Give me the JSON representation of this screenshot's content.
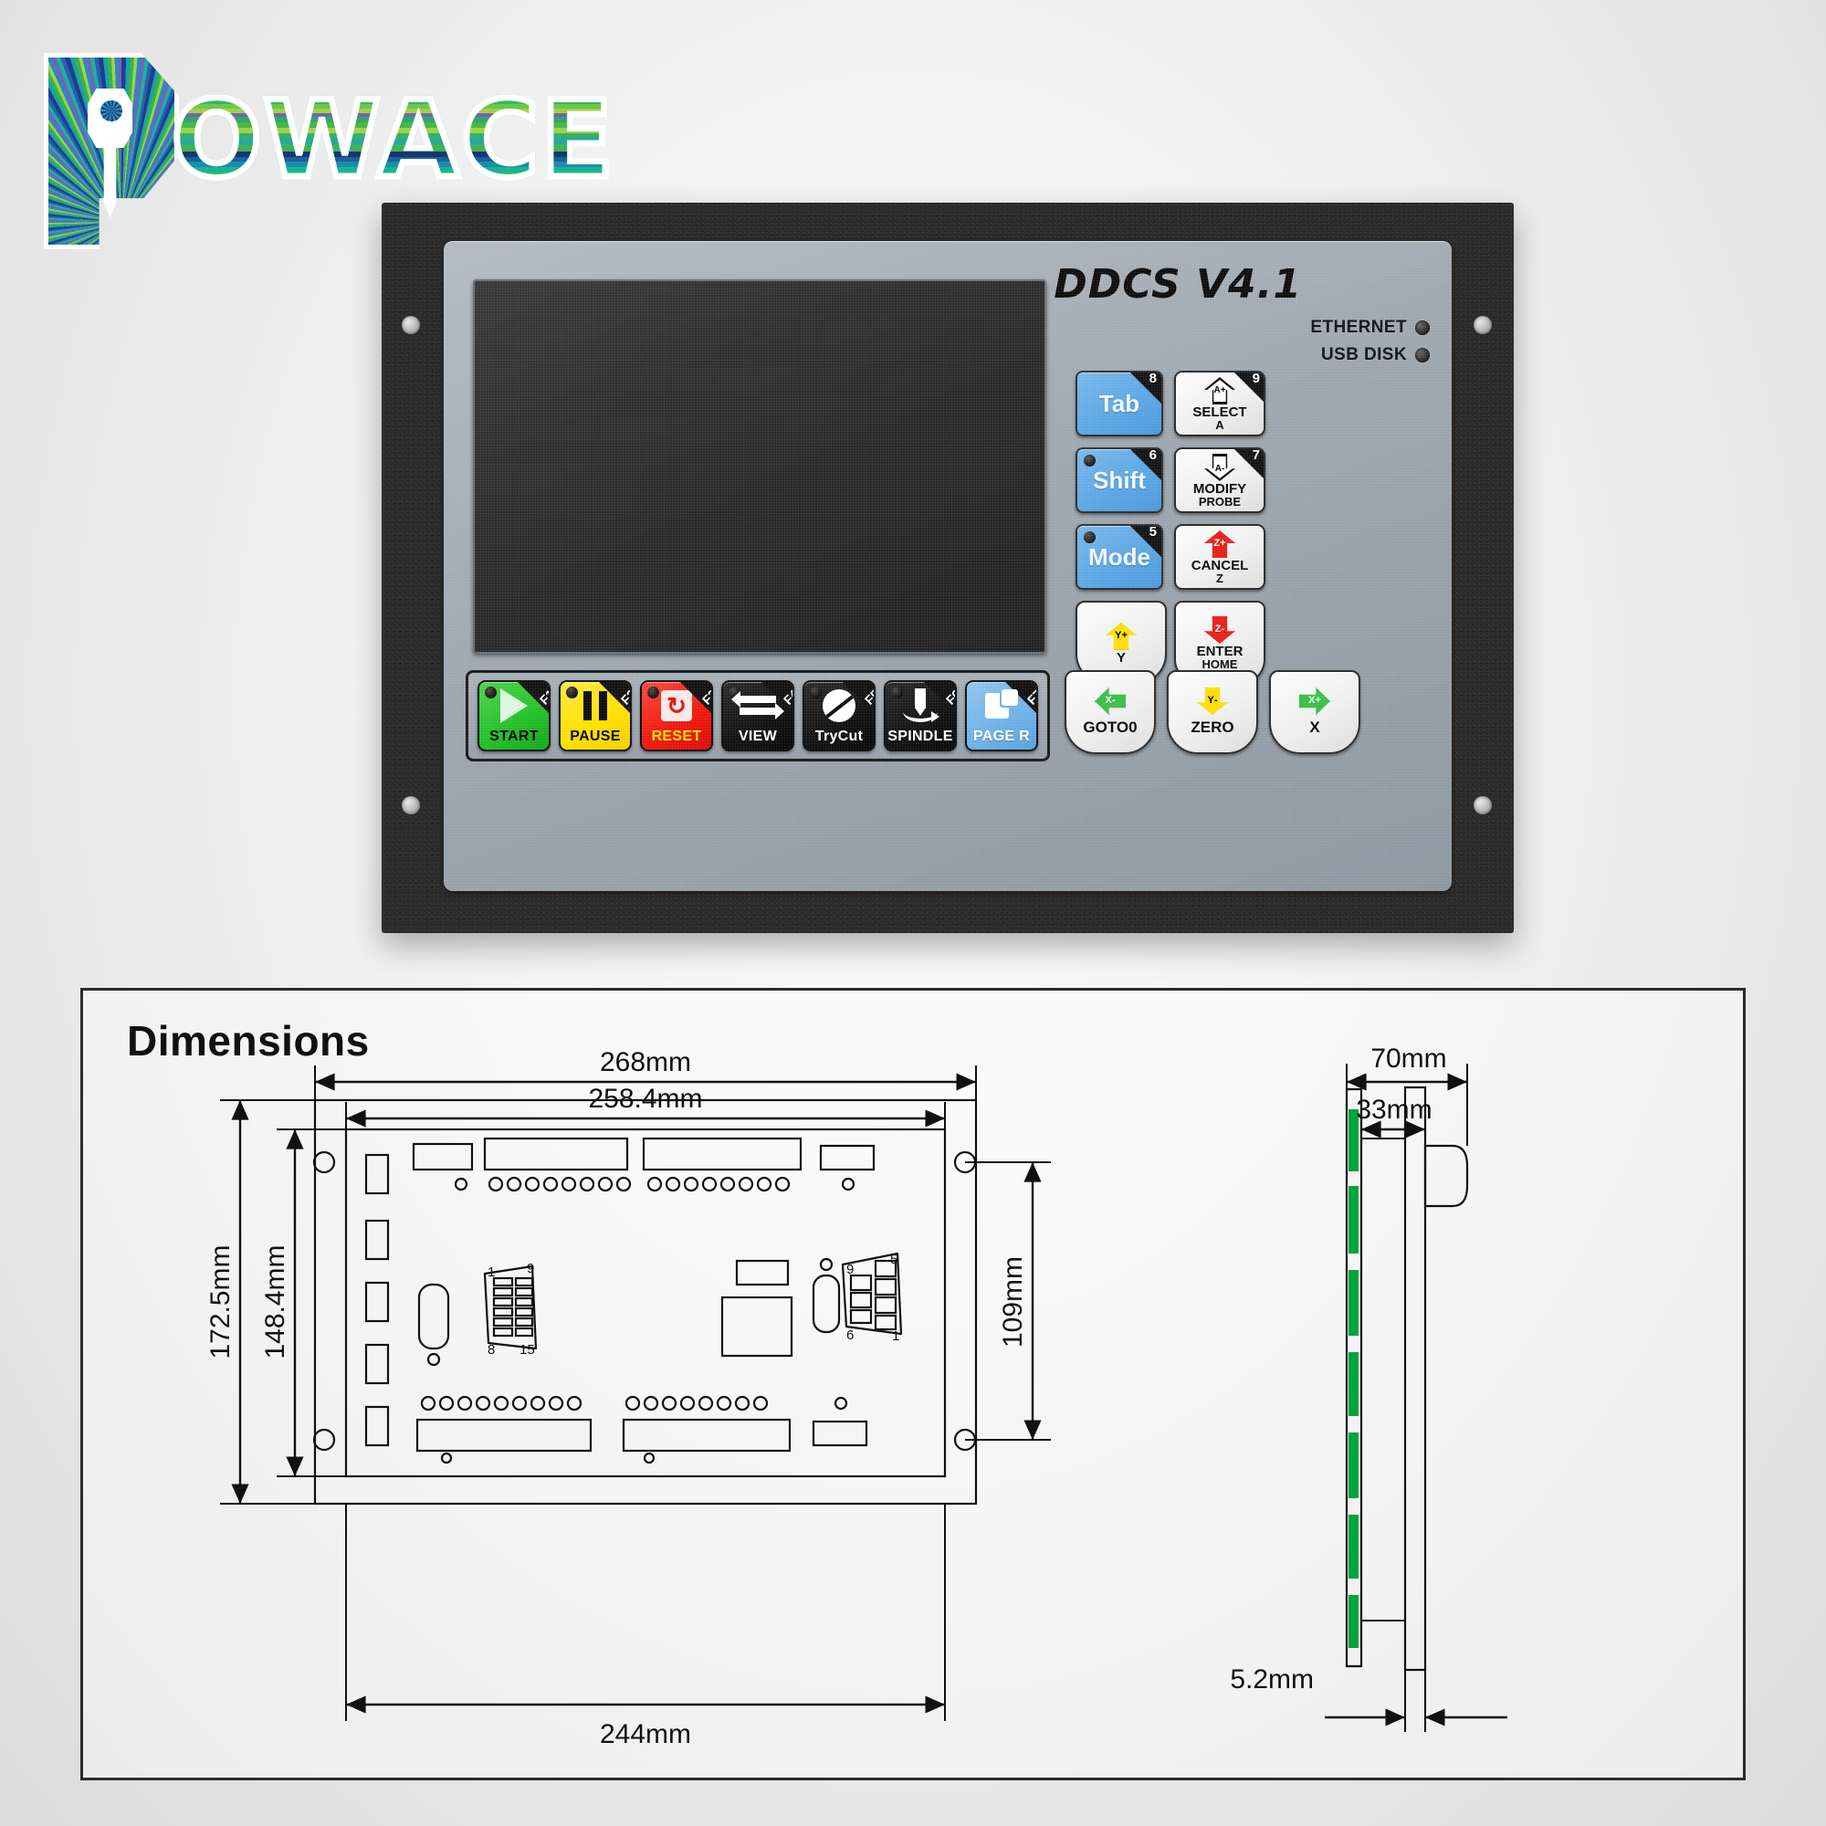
{
  "logo": {
    "brand_text": "OWACE",
    "full_name": "POWACE",
    "icon": "key-in-p-icon"
  },
  "device": {
    "model_label": "DDCS V4.1",
    "indicators": [
      {
        "label": "ETHERNET",
        "icon": "led-indicator"
      },
      {
        "label": "USB DISK",
        "icon": "led-indicator"
      }
    ],
    "screen": {
      "name": "lcd-display",
      "state": "off"
    },
    "keypad_fn_column": [
      {
        "label": "Tab",
        "number": "8",
        "color": "#5ea8e5",
        "has_led": false
      },
      {
        "label": "Shift",
        "number": "6",
        "color": "#5ea8e5",
        "has_led": true
      },
      {
        "label": "Mode",
        "number": "5",
        "color": "#5ea8e5",
        "has_led": true
      }
    ],
    "keypad_arrow_column": [
      {
        "line1": "SELECT",
        "line2": "A",
        "number": "9",
        "arrow": "up",
        "arrow_color": "#ffffff",
        "axis": "A",
        "sign": "+"
      },
      {
        "line1": "MODIFY",
        "line2": "PROBE",
        "number": "7",
        "arrow": "down",
        "arrow_color": "#ffffff",
        "axis": "A",
        "sign": "-"
      },
      {
        "line1": "CANCEL",
        "line2": "Z",
        "number": "",
        "arrow": "up",
        "arrow_color": "#e8231c",
        "axis": "Z",
        "sign": "+"
      },
      {
        "line1": "ENTER",
        "line2": "HOME",
        "number": "",
        "arrow": "down",
        "arrow_color": "#e8231c",
        "axis": "Z",
        "sign": "-"
      }
    ],
    "keypad_y_key": {
      "line1": "Y",
      "arrow": "up",
      "arrow_color": "#ffde0a",
      "axis": "Y",
      "sign": "+"
    },
    "function_row": [
      {
        "label": "START",
        "fkey": "F1",
        "color": "#25c02a",
        "glyph": "play-icon"
      },
      {
        "label": "PAUSE",
        "fkey": "F2",
        "color": "#ffe000",
        "glyph": "pause-icon"
      },
      {
        "label": "RESET",
        "fkey": "F3",
        "color": "#f01a10",
        "glyph": "reset-loop-icon"
      },
      {
        "label": "VIEW",
        "fkey": "F4",
        "color": "#151515",
        "glyph": "swap-arrows-icon"
      },
      {
        "label": "TryCut",
        "fkey": "F5",
        "color": "#151515",
        "glyph": "cut-disc-icon"
      },
      {
        "label": "SPINDLE",
        "fkey": "F6",
        "color": "#151515",
        "glyph": "spindle-tool-icon"
      },
      {
        "label": "PAGE R",
        "fkey": "F7",
        "color": "#6fb2e8",
        "glyph": "page-icon"
      }
    ],
    "bottom_keys": [
      {
        "label": "GOTO0",
        "arrow": "left",
        "arrow_color": "#3fbf4a",
        "axis": "X",
        "sign": "-"
      },
      {
        "label": "ZERO",
        "arrow": "down",
        "arrow_color": "#ffde0a",
        "axis": "Y",
        "sign": "-"
      },
      {
        "label": "X",
        "arrow": "right",
        "arrow_color": "#3fbf4a",
        "axis": "X",
        "sign": "+"
      }
    ]
  },
  "dimensions_panel": {
    "title": "Dimensions",
    "front_view": {
      "width_outer": "268mm",
      "width_inner": "258.4mm",
      "width_bottom": "244mm",
      "height_outer": "172.5mm",
      "height_inner": "148.4mm",
      "height_right": "109mm"
    },
    "side_view": {
      "depth_total": "70mm",
      "depth_body": "33mm",
      "bezel_thickness": "5.2mm"
    },
    "connector_db15_pins": {
      "top_left": "1",
      "top_right": "9",
      "bottom_left": "8",
      "bottom_right": "15"
    },
    "connector_db9_pins": {
      "top_left": "9",
      "top_right": "5",
      "bottom_left": "6",
      "bottom_right": "1"
    }
  }
}
